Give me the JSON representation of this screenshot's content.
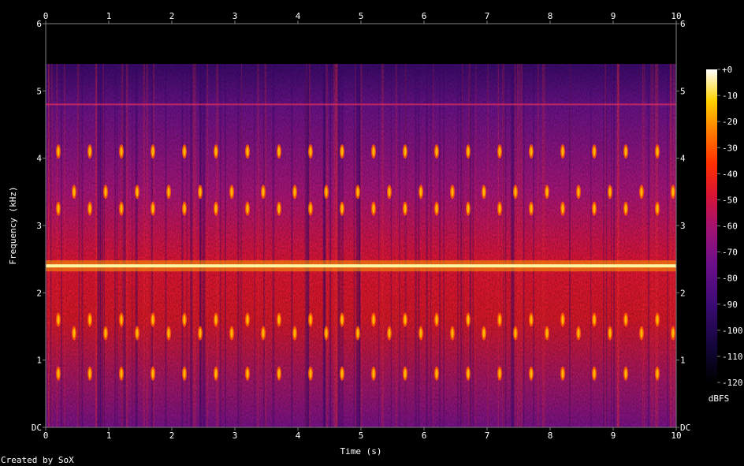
{
  "chart_data": {
    "type": "heatmap",
    "title": "",
    "xlabel": "Time (s)",
    "ylabel": "Frequency (kHz)",
    "xlim": [
      0,
      10
    ],
    "ylim": [
      0,
      6
    ],
    "x_ticks": [
      "0",
      "1",
      "2",
      "3",
      "4",
      "5",
      "6",
      "7",
      "8",
      "9",
      "10"
    ],
    "y_ticks": [
      "DC",
      "1",
      "2",
      "3",
      "4",
      "5",
      "6"
    ],
    "colorbar": {
      "label": "dBFS",
      "range": [
        -120,
        0
      ],
      "ticks": [
        "+0",
        "-10",
        "-20",
        "-30",
        "-40",
        "-50",
        "-60",
        "-70",
        "-80",
        "-90",
        "-100",
        "-110",
        "-120"
      ]
    },
    "content_cutoff_khz": 5.4,
    "continuous_tone_khz": 2.4,
    "tone_bursts": [
      {
        "freq_khz": 0.8,
        "times_s": [
          0.2,
          0.7,
          1.2,
          1.7,
          2.2,
          2.7,
          3.2,
          3.7,
          4.2,
          4.7,
          5.2,
          5.7,
          6.2,
          6.7,
          7.2,
          7.7,
          8.2,
          8.7,
          9.2,
          9.7
        ]
      },
      {
        "freq_khz": 1.4,
        "times_s": [
          0.45,
          0.95,
          1.45,
          1.95,
          2.45,
          2.95,
          3.45,
          3.95,
          4.45,
          4.95,
          5.45,
          5.95,
          6.45,
          6.95,
          7.45,
          7.95,
          8.45,
          8.95,
          9.45,
          9.95
        ]
      },
      {
        "freq_khz": 1.6,
        "times_s": [
          0.2,
          0.7,
          1.2,
          1.7,
          2.2,
          2.7,
          3.2,
          3.7,
          4.2,
          4.7,
          5.2,
          5.7,
          6.2,
          6.7,
          7.2,
          7.7,
          8.2,
          8.7,
          9.2,
          9.7
        ]
      },
      {
        "freq_khz": 3.25,
        "times_s": [
          0.2,
          0.7,
          1.2,
          1.7,
          2.2,
          2.7,
          3.2,
          3.7,
          4.2,
          4.7,
          5.2,
          5.7,
          6.2,
          6.7,
          7.2,
          7.7,
          8.2,
          8.7,
          9.2,
          9.7
        ]
      },
      {
        "freq_khz": 3.5,
        "times_s": [
          0.45,
          0.95,
          1.45,
          1.95,
          2.45,
          2.95,
          3.45,
          3.95,
          4.45,
          4.95,
          5.45,
          5.95,
          6.45,
          6.95,
          7.45,
          7.95,
          8.45,
          8.95,
          9.45,
          9.95
        ]
      },
      {
        "freq_khz": 4.1,
        "times_s": [
          0.2,
          0.7,
          1.2,
          1.7,
          2.2,
          2.7,
          3.2,
          3.7,
          4.2,
          4.7,
          5.2,
          5.7,
          6.2,
          6.7,
          7.2,
          7.7,
          8.2,
          8.7,
          9.2,
          9.7
        ]
      }
    ],
    "faint_line_khz": 4.8
  },
  "footer": {
    "credit": "Created by SoX"
  }
}
